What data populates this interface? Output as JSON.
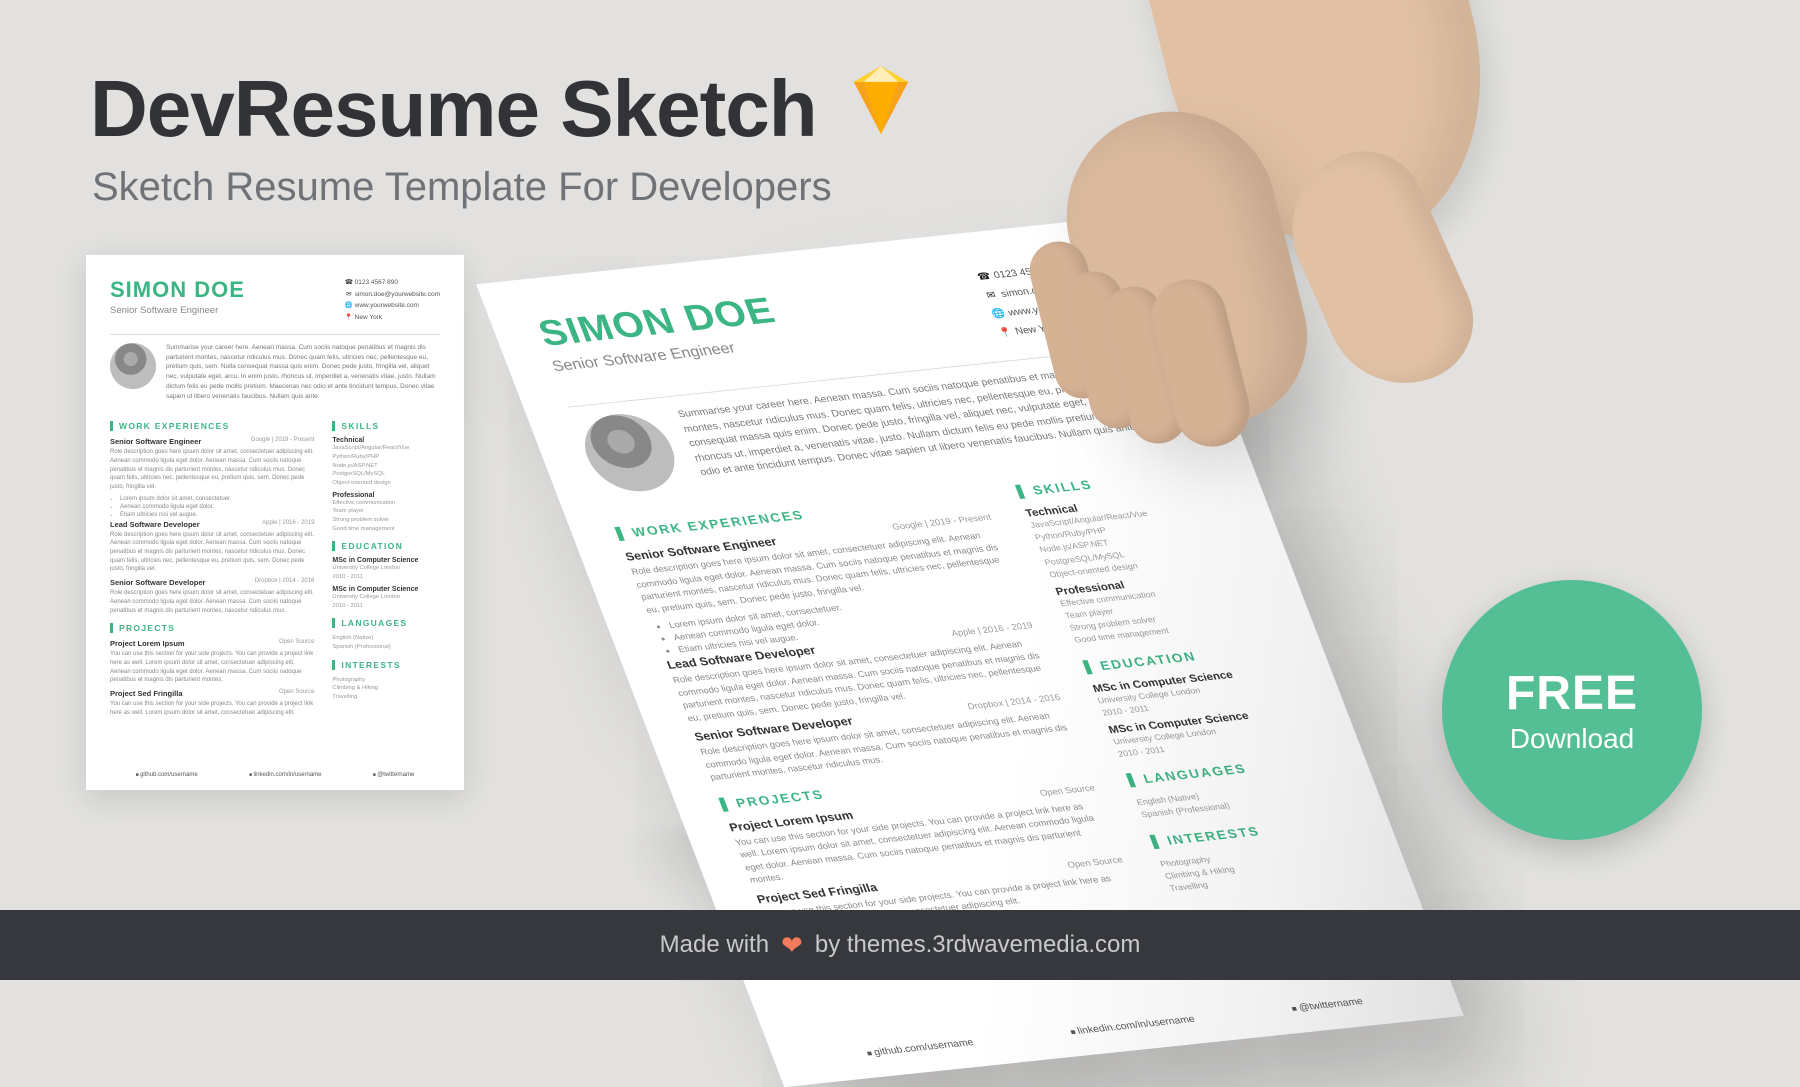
{
  "header": {
    "title": "DevResume Sketch",
    "subtitle": "Sketch Resume Template For Developers"
  },
  "resume": {
    "name": "SIMON DOE",
    "role": "Senior Software Engineer",
    "contacts": {
      "phone": "0123 4567 890",
      "email": "simon.doe@yourwebsite.com",
      "web": "www.yourwebsite.com",
      "location": "New York"
    },
    "summary": "Summarise your career here. Aenean massa. Cum sociis natoque penatibus et magnis dis parturient montes, nascetur ridiculus mus. Donec quam felis, ultricies nec, pellentesque eu, pretium quis, sem. Nulla consequat massa quis enim. Donec pede justo, fringilla vel, aliquet nec, vulputate eget, arcu. In enim justo, rhoncus ut, imperdiet a, venenatis vitae, justo. Nullam dictum felis eu pede mollis pretium. Maecenas nec odio et ante tincidunt tempus. Donec vitae sapien ut libero venenatis faucibus. Nullam quis ante.",
    "sections": {
      "work": "WORK EXPERIENCES",
      "projects": "PROJECTS",
      "skills": "SKILLS",
      "education": "EDUCATION",
      "languages": "LANGUAGES",
      "interests": "INTERESTS"
    },
    "jobs": [
      {
        "title": "Senior Software Engineer",
        "right": "Google | 2019 - Present",
        "desc": "Role description goes here ipsum dolor sit amet, consectetuer adipiscing elit. Aenean commodo ligula eget dolor. Aenean massa. Cum sociis natoque penatibus et magnis dis parturient montes, nascetur ridiculus mus. Donec quam felis, ultricies nec, pellentesque eu, pretium quis, sem. Donec pede justo, fringilla vel.",
        "bullets": [
          "Lorem ipsum dolor sit amet, consectetuer.",
          "Aenean commodo ligula eget dolor.",
          "Etiam ultricies nisi vel augue."
        ]
      },
      {
        "title": "Lead Software Developer",
        "right": "Apple | 2016 - 2019",
        "desc": "Role description goes here ipsum dolor sit amet, consectetuer adipiscing elit. Aenean commodo ligula eget dolor. Aenean massa. Cum sociis natoque penatibus et magnis dis parturient montes, nascetur ridiculus mus. Donec quam felis, ultricies nec, pellentesque eu, pretium quis, sem. Donec pede justo, fringilla vel."
      },
      {
        "title": "Senior Software Developer",
        "right": "Dropbox | 2014 - 2016",
        "desc": "Role description goes here ipsum dolor sit amet, consectetuer adipiscing elit. Aenean commodo ligula eget dolor. Aenean massa. Cum sociis natoque penatibus et magnis dis parturient montes, nascetur ridiculus mus."
      }
    ],
    "projects": [
      {
        "title": "Project Lorem Ipsum",
        "right": "Open Source",
        "desc": "You can use this section for your side projects. You can provide a project link here as well. Lorem ipsum dolor sit amet, consectetuer adipiscing elit. Aenean commodo ligula eget dolor. Aenean massa. Cum sociis natoque penatibus et magnis dis parturient montes."
      },
      {
        "title": "Project Sed Fringilla",
        "right": "Open Source",
        "desc": "You can use this section for your side projects. You can provide a project link here as well. Lorem ipsum dolor sit amet, consectetuer adipiscing elit."
      }
    ],
    "skills": {
      "tech_h": "Technical",
      "tech": "JavaScript/Angular/React/Vue\nPython/Ruby/PHP\nNode.js/ASP.NET\nPostgreSQL/MySQL\nObject-oriented design",
      "pro_h": "Professional",
      "pro": "Effective communication\nTeam player\nStrong problem solver\nGood time management"
    },
    "education": [
      {
        "deg": "MSc in Computer Science",
        "school": "University College London",
        "years": "2010 - 2011"
      },
      {
        "deg": "MSc in Computer Science",
        "school": "University College London",
        "years": "2010 - 2011"
      }
    ],
    "languages": "English (Native)\nSpanish (Professional)",
    "interests": "Photography\nClimbing & Hiking\nTravelling",
    "footer_links": {
      "github": "github.com/username",
      "linkedin": "linkedin.com/in/username",
      "twitter": "@twittername"
    }
  },
  "badge": {
    "free": "FREE",
    "download": "Download"
  },
  "footer": {
    "made": "Made with",
    "by": "by themes.3rdwavemedia.com"
  }
}
